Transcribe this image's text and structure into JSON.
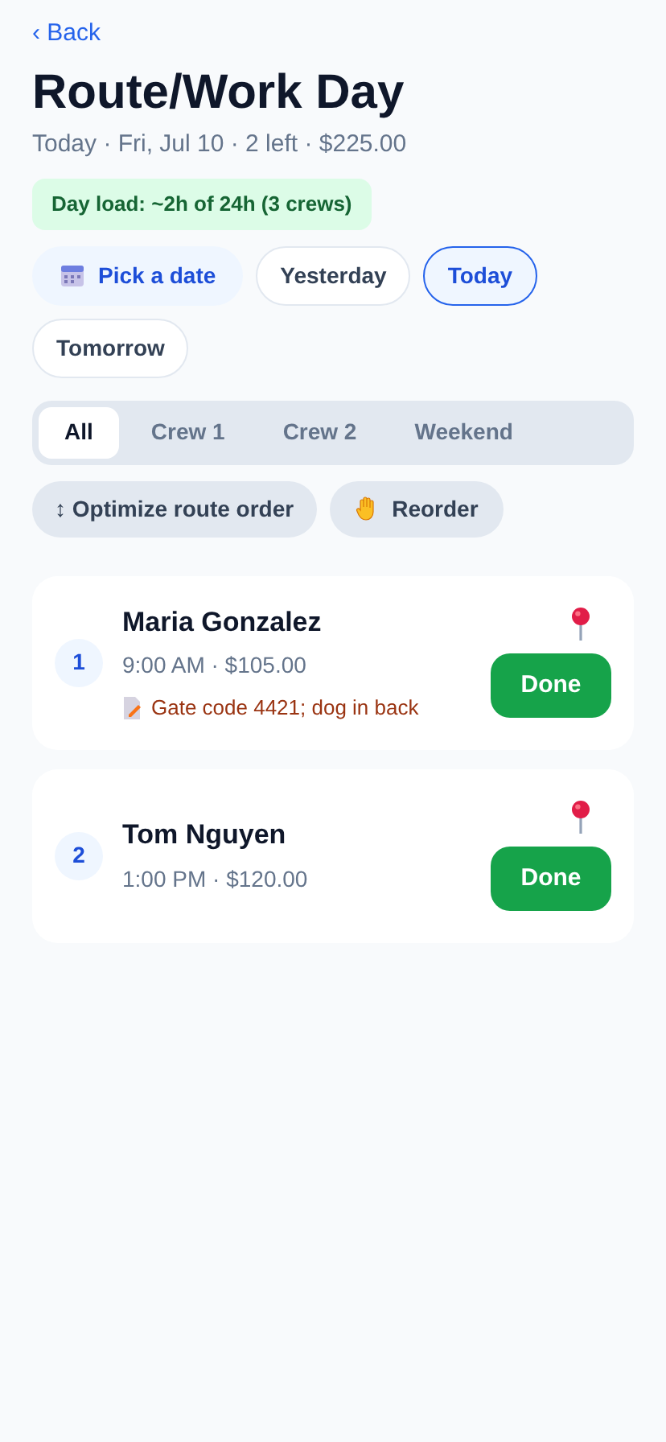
{
  "back": "‹ Back",
  "title": "Route/Work Day",
  "subtitle": "Today · Fri, Jul 10 · 2 left · $225.00",
  "load_badge": "Day load: ~2h of 24h (3 crews)",
  "date_buttons": [
    {
      "kind": "picker",
      "label": "Pick a date",
      "selected": false
    },
    {
      "kind": "day",
      "label": "Yesterday",
      "selected": false
    },
    {
      "kind": "day",
      "label": "Today",
      "selected": true
    },
    {
      "kind": "day",
      "label": "Tomorrow",
      "selected": false
    }
  ],
  "crew_tabs": [
    {
      "label": "All",
      "selected": true
    },
    {
      "label": "Crew 1",
      "selected": false
    },
    {
      "label": "Crew 2",
      "selected": false
    },
    {
      "label": "Weekend",
      "selected": false
    }
  ],
  "actions": [
    {
      "kind": "optimize",
      "label": "↕ Optimize route order"
    },
    {
      "kind": "reorder",
      "label": "Reorder"
    }
  ],
  "stops": [
    {
      "number": "1",
      "name": "Maria Gonzalez",
      "details": "9:00 AM · $105.00",
      "note": "Gate code 4421; dog in back",
      "button": "Done"
    },
    {
      "number": "2",
      "name": "Tom Nguyen",
      "details": "1:00 PM · $120.00",
      "button": "Done"
    }
  ]
}
